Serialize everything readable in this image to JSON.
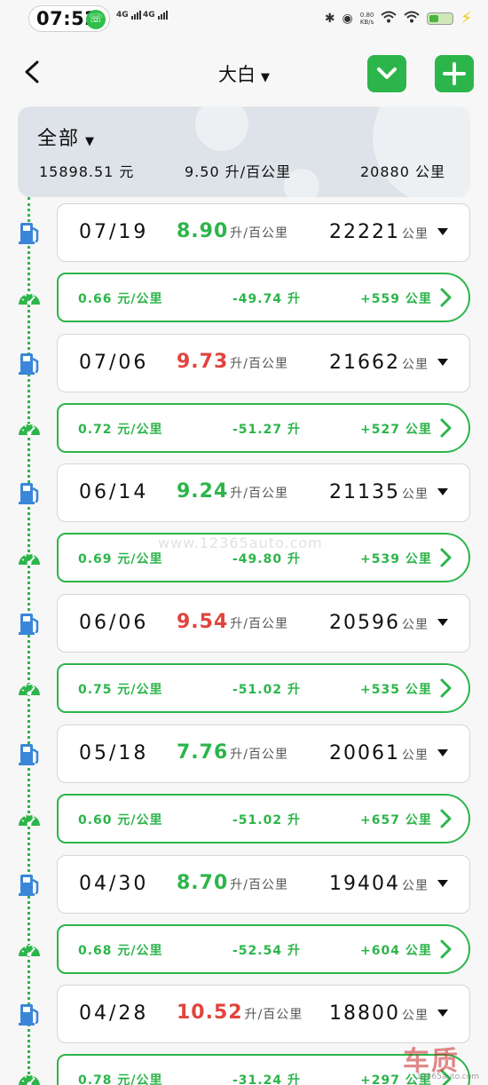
{
  "status_bar": {
    "time": "07:52",
    "signal1": "4G",
    "signal2": "4G",
    "net_speed": "0.80",
    "net_unit": "KB/s"
  },
  "header": {
    "title": "大白",
    "back_icon": "back-arrow-icon",
    "filter_icon": "chevron-down-icon",
    "add_icon": "plus-icon",
    "accent": "#2cb54a"
  },
  "summary": {
    "title": "全部",
    "total_cost": "15898.51 元",
    "avg_consumption": "9.50 升/百公里",
    "total_distance": "20880 公里"
  },
  "records": [
    {
      "date": "07/19",
      "rate": "8.90",
      "rate_status": "good",
      "rate_unit": "升/百公里",
      "odometer": "22221",
      "odo_unit": "公里",
      "trip": {
        "cost_per_km": "0.66 元/公里",
        "fuel": "-49.74 升",
        "distance": "+559 公里"
      }
    },
    {
      "date": "07/06",
      "rate": "9.73",
      "rate_status": "bad",
      "rate_unit": "升/百公里",
      "odometer": "21662",
      "odo_unit": "公里",
      "trip": {
        "cost_per_km": "0.72 元/公里",
        "fuel": "-51.27 升",
        "distance": "+527 公里"
      }
    },
    {
      "date": "06/14",
      "rate": "9.24",
      "rate_status": "good",
      "rate_unit": "升/百公里",
      "odometer": "21135",
      "odo_unit": "公里",
      "trip": {
        "cost_per_km": "0.69 元/公里",
        "fuel": "-49.80 升",
        "distance": "+539 公里"
      }
    },
    {
      "date": "06/06",
      "rate": "9.54",
      "rate_status": "bad",
      "rate_unit": "升/百公里",
      "odometer": "20596",
      "odo_unit": "公里",
      "trip": {
        "cost_per_km": "0.75 元/公里",
        "fuel": "-51.02 升",
        "distance": "+535 公里"
      }
    },
    {
      "date": "05/18",
      "rate": "7.76",
      "rate_status": "good",
      "rate_unit": "升/百公里",
      "odometer": "20061",
      "odo_unit": "公里",
      "trip": {
        "cost_per_km": "0.60 元/公里",
        "fuel": "-51.02 升",
        "distance": "+657 公里"
      }
    },
    {
      "date": "04/30",
      "rate": "8.70",
      "rate_status": "good",
      "rate_unit": "升/百公里",
      "odometer": "19404",
      "odo_unit": "公里",
      "trip": {
        "cost_per_km": "0.68 元/公里",
        "fuel": "-52.54 升",
        "distance": "+604 公里"
      }
    },
    {
      "date": "04/28",
      "rate": "10.52",
      "rate_status": "bad",
      "rate_unit": "升/百公里",
      "odometer": "18800",
      "odo_unit": "公里",
      "trip": {
        "cost_per_km": "0.78 元/公里",
        "fuel": "-31.24 升",
        "distance": "+297 公里"
      }
    }
  ],
  "colors": {
    "good": "#2cb54a",
    "bad": "#e0443d",
    "fuel_icon": "#3a86d8",
    "gauge_icon": "#2cb54a"
  },
  "watermark": "www.12365auto.com",
  "logo": {
    "text": "车质网",
    "url": "12365auto.com"
  }
}
